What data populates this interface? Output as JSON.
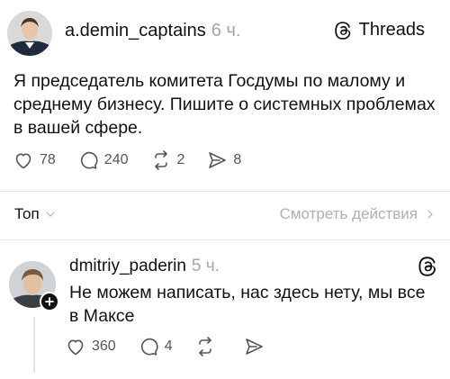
{
  "post": {
    "author": "a.demin_captains",
    "time": "6 ч.",
    "brand": "Threads",
    "text": "Я председатель комитета Госдумы по малому и среднему бизнесу. Пишите о системных проблемах в вашей сфере.",
    "likes": "78",
    "comments": "240",
    "reposts": "2",
    "shares": "8"
  },
  "sort": {
    "label": "Топ",
    "view_activity": "Смотреть действия"
  },
  "reply": {
    "author": "dmitriy_paderin",
    "time": "5 ч.",
    "text": "Не можем написать, нас здесь нету, мы все в Максе",
    "likes": "360",
    "comments": "4"
  }
}
